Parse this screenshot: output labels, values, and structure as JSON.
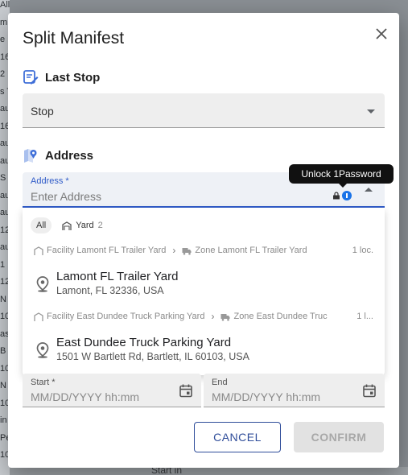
{
  "background": {
    "left_fragments": [
      "All",
      "m",
      "e F",
      "16",
      "2",
      "s T",
      "au",
      "16",
      "au",
      "au",
      "S",
      "au",
      "au",
      "12",
      "au",
      "1",
      "12",
      "N",
      "10",
      "ast",
      "B",
      "10",
      "N",
      "10",
      "in",
      "Pe",
      "10"
    ],
    "bottom_text": "Start in"
  },
  "dialog": {
    "title": "Split Manifest",
    "last_stop": {
      "heading": "Last Stop",
      "select_value": "Stop"
    },
    "address": {
      "heading": "Address",
      "field_label": "Address *",
      "placeholder": "Enter Address"
    },
    "tooltip": "Unlock 1Password",
    "dropdown": {
      "chips": [
        {
          "label": "All",
          "count": ""
        },
        {
          "label": "Yard",
          "count": "2"
        }
      ],
      "groups": [
        {
          "crumb_facility": "Facility Lamont FL Trailer Yard",
          "crumb_zone": "Zone Lamont FL Trailer Yard",
          "crumb_count": "1 loc.",
          "name": "Lamont FL Trailer Yard",
          "address": "Lamont, FL 32336, USA"
        },
        {
          "crumb_facility": "Facility East Dundee Truck Parking Yard",
          "crumb_zone": "Zone East Dundee Truc",
          "crumb_count": "1 l...",
          "name": "East Dundee Truck Parking Yard",
          "address": "1501 W Bartlett Rd, Bartlett, IL 60103, USA"
        }
      ]
    },
    "start": {
      "label": "Start *",
      "placeholder": "MM/DD/YYYY hh:mm"
    },
    "end": {
      "label": "End",
      "placeholder": "MM/DD/YYYY hh:mm"
    },
    "buttons": {
      "cancel": "CANCEL",
      "confirm": "CONFIRM"
    }
  },
  "colors": {
    "accent": "#2f5bc8",
    "button_outline": "#2f4d9a",
    "disabled": "#e2e2e2"
  }
}
